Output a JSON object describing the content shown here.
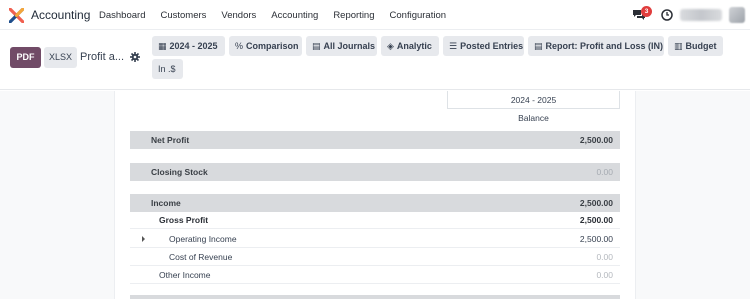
{
  "app": {
    "name": "Accounting"
  },
  "menu": [
    "Dashboard",
    "Customers",
    "Vendors",
    "Accounting",
    "Reporting",
    "Configuration"
  ],
  "navbar": {
    "message_count": "3"
  },
  "control": {
    "pdf_label": "PDF",
    "xlsx_label": "XLSX",
    "report_title": "Profit a...",
    "filters": [
      {
        "icon": "calendar-icon",
        "glyph": "▦",
        "label": "2024 - 2025"
      },
      {
        "icon": "percent-icon",
        "glyph": "%",
        "label": "Comparison"
      },
      {
        "icon": "book-icon",
        "glyph": "▤",
        "label": "All Journals"
      },
      {
        "icon": "layers-icon",
        "glyph": "◈",
        "label": "Analytic"
      },
      {
        "icon": "sliders-icon",
        "glyph": "☰",
        "label": "Posted Entries"
      },
      {
        "icon": "book-icon",
        "glyph": "▤",
        "label": "Report: Profit and Loss (IN)"
      },
      {
        "icon": "bar-chart-icon",
        "glyph": "▥",
        "label": "Budget"
      },
      {
        "icon": "",
        "glyph": "",
        "label": "In .$"
      }
    ]
  },
  "report": {
    "period": "2024 - 2025",
    "column": "Balance",
    "rows": [
      {
        "label": "Net Profit",
        "value": "2,500.00",
        "type": "section"
      },
      {
        "label": "Closing Stock",
        "value": "0.00",
        "type": "section",
        "zero": true
      },
      {
        "label": "Income",
        "value": "2,500.00",
        "type": "section"
      },
      {
        "label": "Gross Profit",
        "value": "2,500.00",
        "type": "sub-bold"
      },
      {
        "label": "Operating Income",
        "value": "2,500.00",
        "type": "sub-expand"
      },
      {
        "label": "Cost of Revenue",
        "value": "0.00",
        "type": "sub-zero"
      },
      {
        "label": "Other Income",
        "value": "0.00",
        "type": "sub-muted"
      }
    ]
  },
  "colors": {
    "brand": "#714b67",
    "badge": "#e03d3d",
    "section_bg": "#d8dadd"
  }
}
